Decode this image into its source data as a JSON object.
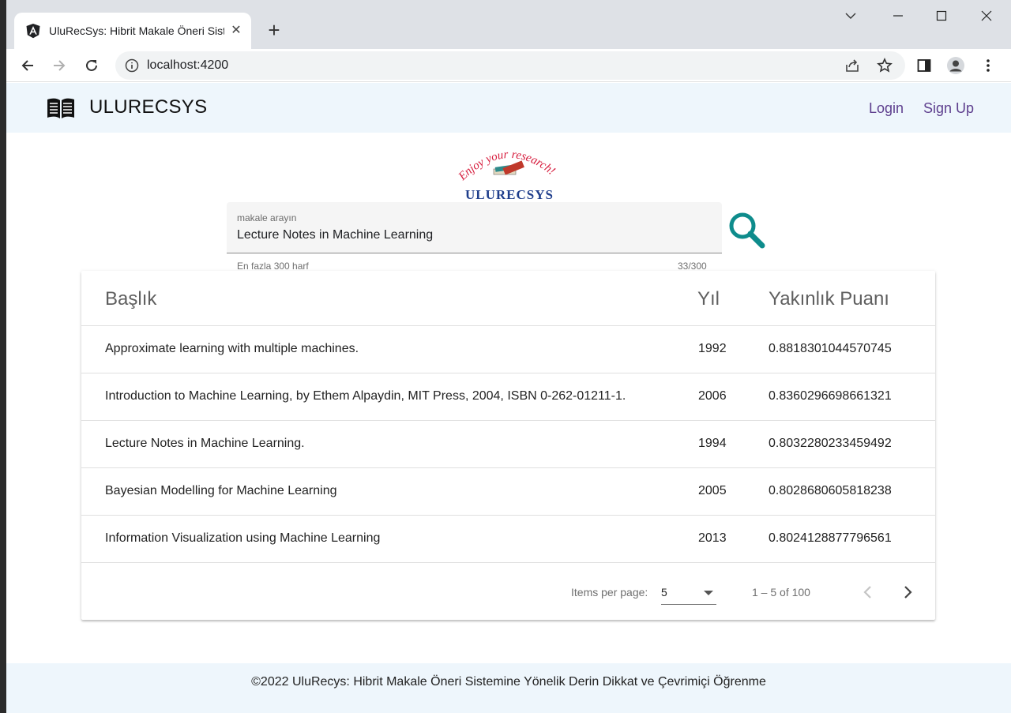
{
  "browser": {
    "tab_title": "UluRecSys: Hibrit Makale Öneri Sistemine Yönelik Derin Dikkat",
    "url": "localhost:4200"
  },
  "header": {
    "brand": "ULURECSYS",
    "login": "Login",
    "signup": "Sign Up"
  },
  "logo": {
    "tagline": "Enjoy your research!",
    "name": "ULURECSYS"
  },
  "search": {
    "label": "makale arayın",
    "value": "Lecture Notes in Machine Learning",
    "hint": "En fazla 300 harf",
    "count": "33/300"
  },
  "table": {
    "headers": {
      "title": "Başlık",
      "year": "Yıl",
      "score": "Yakınlık Puanı"
    },
    "rows": [
      {
        "title": "Approximate learning with multiple machines.",
        "year": "1992",
        "score": "0.8818301044570745"
      },
      {
        "title": "Introduction to Machine Learning, by Ethem Alpaydin, MIT Press, 2004, ISBN 0-262-01211-1.",
        "year": "2006",
        "score": "0.8360296698661321"
      },
      {
        "title": "Lecture Notes in Machine Learning.",
        "year": "1994",
        "score": "0.8032280233459492"
      },
      {
        "title": "Bayesian Modelling for Machine Learning",
        "year": "2005",
        "score": "0.8028680605818238"
      },
      {
        "title": "Information Visualization using Machine Learning",
        "year": "2013",
        "score": "0.8024128877796561"
      }
    ]
  },
  "paginator": {
    "items_label": "Items per page:",
    "page_size": "5",
    "range": "1 – 5 of 100"
  },
  "footer": {
    "text": "©2022 UluRecys: Hibrit Makale Öneri Sistemine Yönelik Derin Dikkat ve Çevrimiçi Öğrenme"
  },
  "colors": {
    "accent": "#5e3f8e",
    "search_icon": "#0e8c8c",
    "header_bg": "#eef6fc"
  }
}
